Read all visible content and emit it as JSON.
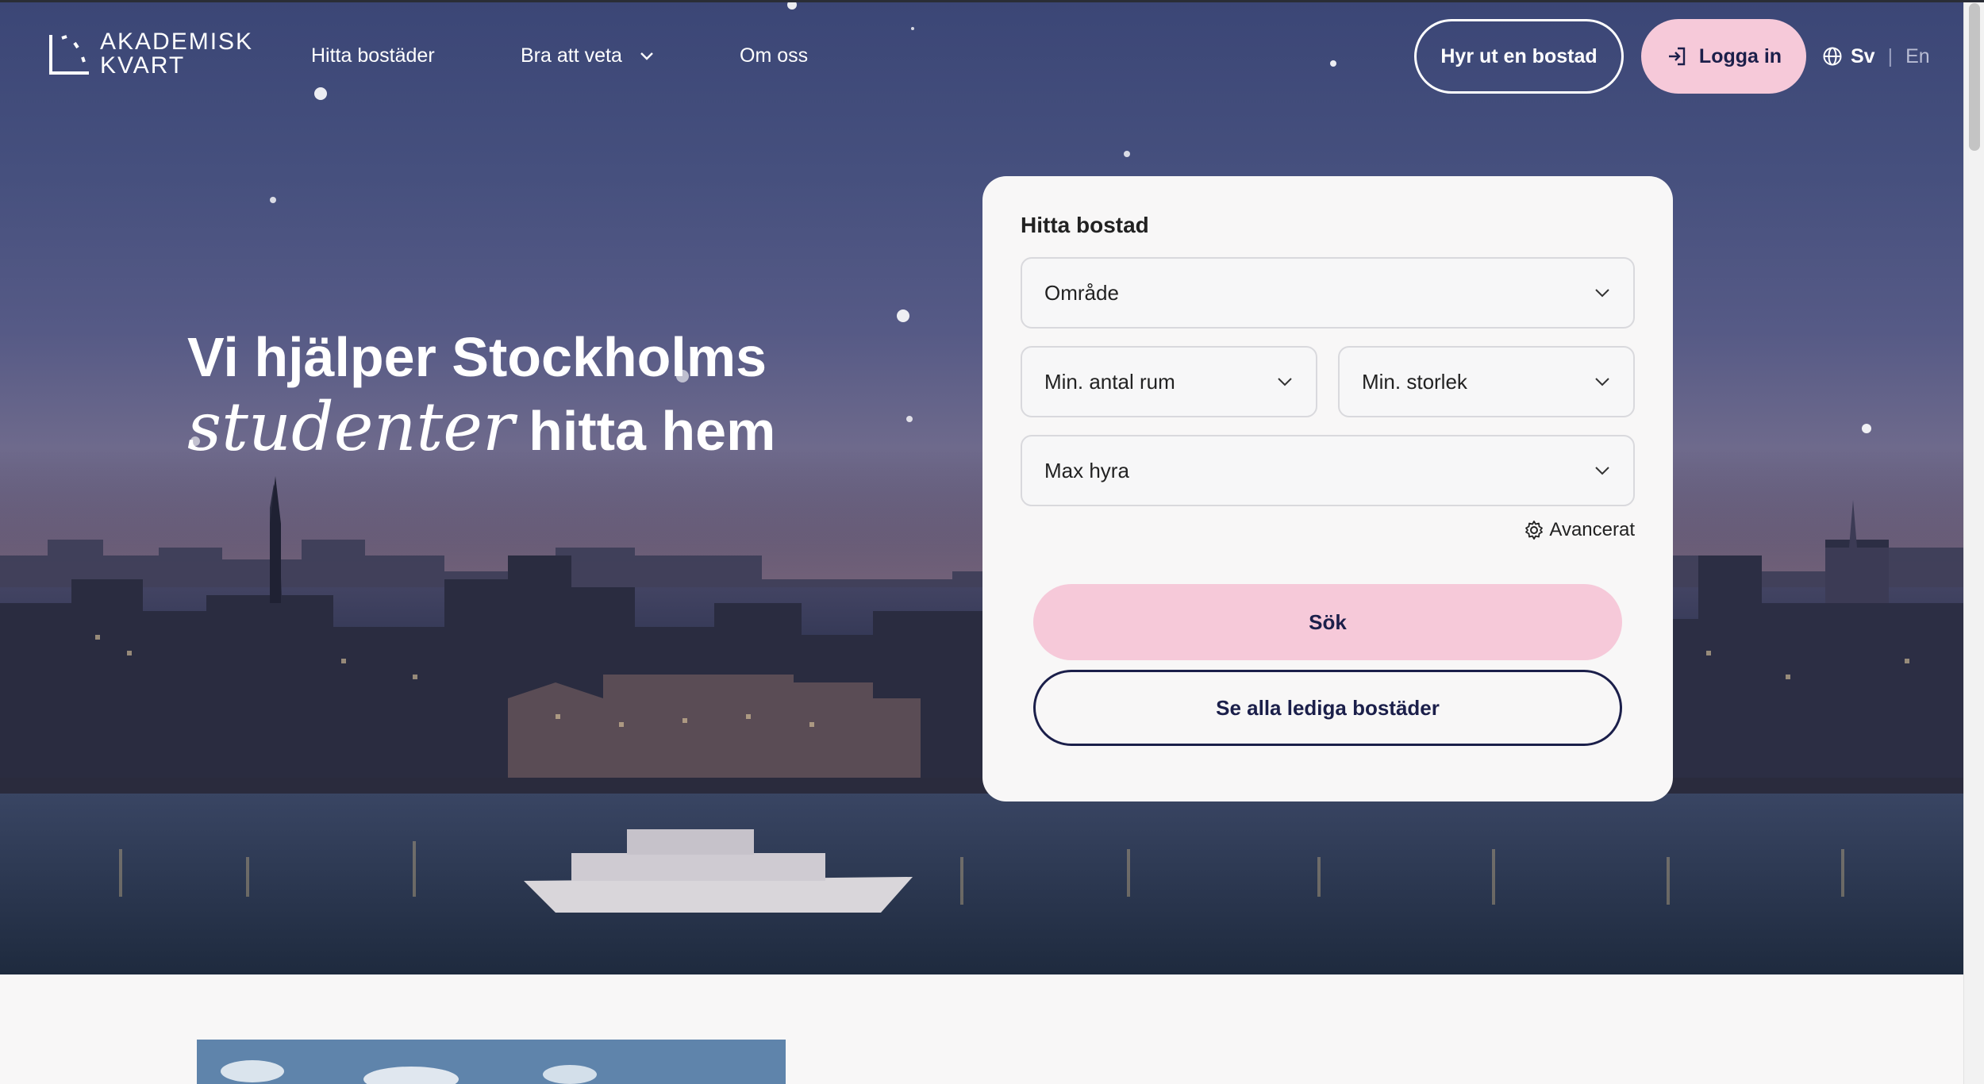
{
  "header": {
    "logo_line1": "AKADEMISK",
    "logo_line2": "KVART",
    "nav": [
      {
        "label": "Hitta bostäder"
      },
      {
        "label": "Bra att veta"
      },
      {
        "label": "Om oss"
      }
    ],
    "rent_out_label": "Hyr ut en bostad",
    "login_label": "Logga in",
    "lang_active": "Sv",
    "lang_separator": "|",
    "lang_other": "En"
  },
  "hero": {
    "headline_line1": "Vi hjälper Stockholms",
    "headline_italic": "studenter",
    "headline_rest": "hitta hem"
  },
  "search": {
    "title": "Hitta bostad",
    "area_placeholder": "Område",
    "rooms_placeholder": "Min. antal rum",
    "size_placeholder": "Min. storlek",
    "rent_placeholder": "Max hyra",
    "advanced_label": "Avancerat",
    "search_button": "Sök",
    "all_button": "Se alla lediga bostäder"
  },
  "icons": {
    "logo": "akademisk-kvart-logo",
    "dropdown": "chevron-down-icon",
    "login": "login-arrow-icon",
    "language": "globe-icon",
    "advanced": "gear-icon"
  },
  "colors": {
    "accent_pink": "#f6c9d9",
    "navy": "#1b1f4a",
    "card_bg": "#f8f7f7"
  }
}
